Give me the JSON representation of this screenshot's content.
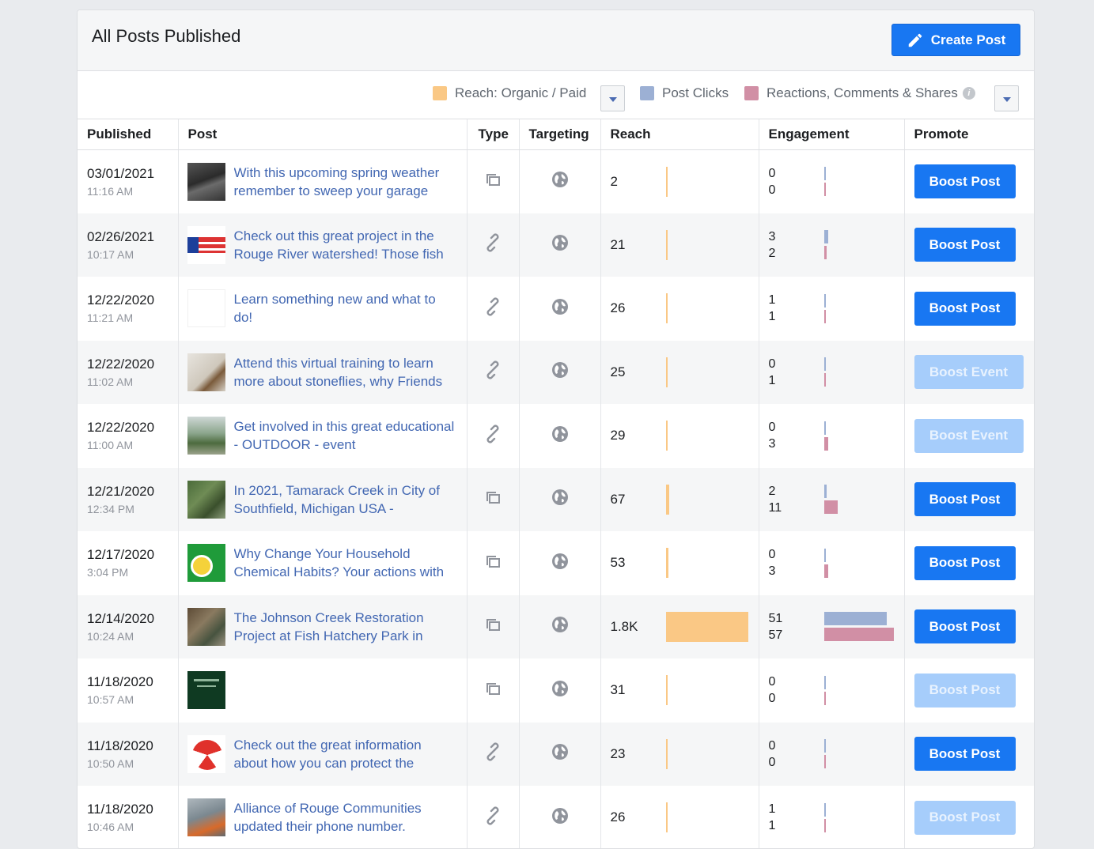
{
  "header": {
    "title": "All Posts Published",
    "create_label": "Create Post"
  },
  "legend": {
    "reach": "Reach: Organic / Paid",
    "clicks": "Post Clicks",
    "reactions": "Reactions, Comments & Shares",
    "colors": {
      "reach": "#fac885",
      "clicks": "#9cb0d4",
      "reactions": "#d18fa5"
    }
  },
  "columns": [
    "Published",
    "Post",
    "Type",
    "Targeting",
    "Reach",
    "Engagement",
    "Promote"
  ],
  "rows": [
    {
      "date": "03/01/2021",
      "time": "11:16 AM",
      "text": "With this upcoming spring weather remember to sweep your garage",
      "type": "album",
      "reach": "2",
      "reach_value": 2,
      "clicks": "0",
      "reactions": "0",
      "promote": "Boost Post",
      "promote_enabled": true,
      "thumb": "garage"
    },
    {
      "date": "02/26/2021",
      "time": "10:17 AM",
      "text": "Check out this great project in the Rouge River watershed! Those fish",
      "type": "link",
      "reach": "21",
      "reach_value": 21,
      "clicks": "3",
      "reactions": "2",
      "promote": "Boost Post",
      "promote_enabled": true,
      "thumb": "flag"
    },
    {
      "date": "12/22/2020",
      "time": "11:21 AM",
      "text": "Learn something new and what to do!",
      "type": "link",
      "reach": "26",
      "reach_value": 26,
      "clicks": "1",
      "reactions": "1",
      "promote": "Boost Post",
      "promote_enabled": true,
      "thumb": "blank"
    },
    {
      "date": "12/22/2020",
      "time": "11:02 AM",
      "text": "Attend this virtual training to learn more about stoneflies, why Friends",
      "type": "link",
      "reach": "25",
      "reach_value": 25,
      "clicks": "0",
      "reactions": "1",
      "promote": "Boost Event",
      "promote_enabled": false,
      "thumb": "stonefly"
    },
    {
      "date": "12/22/2020",
      "time": "11:00 AM",
      "text": "Get involved in this great educational - OUTDOOR - event",
      "type": "link",
      "reach": "29",
      "reach_value": 29,
      "clicks": "0",
      "reactions": "3",
      "promote": "Boost Event",
      "promote_enabled": false,
      "thumb": "outdoor"
    },
    {
      "date": "12/21/2020",
      "time": "12:34 PM",
      "text": "In 2021, Tamarack Creek in City of Southfield, Michigan USA -",
      "type": "album",
      "reach": "67",
      "reach_value": 67,
      "clicks": "2",
      "reactions": "11",
      "promote": "Boost Post",
      "promote_enabled": true,
      "thumb": "creek"
    },
    {
      "date": "12/17/2020",
      "time": "3:04 PM",
      "text": "Why Change Your Household Chemical Habits? Your actions with",
      "type": "album",
      "reach": "53",
      "reach_value": 53,
      "clicks": "0",
      "reactions": "3",
      "promote": "Boost Post",
      "promote_enabled": true,
      "thumb": "green"
    },
    {
      "date": "12/14/2020",
      "time": "10:24 AM",
      "text": "The Johnson Creek Restoration Project at Fish Hatchery Park in",
      "type": "album",
      "reach": "1.8K",
      "reach_value": 1800,
      "clicks": "51",
      "reactions": "57",
      "promote": "Boost Post",
      "promote_enabled": true,
      "thumb": "johnson"
    },
    {
      "date": "11/18/2020",
      "time": "10:57 AM",
      "text": "",
      "type": "album",
      "reach": "31",
      "reach_value": 31,
      "clicks": "0",
      "reactions": "0",
      "promote": "Boost Post",
      "promote_enabled": false,
      "thumb": "dark"
    },
    {
      "date": "11/18/2020",
      "time": "10:50 AM",
      "text": "Check out the great information about how you can protect the",
      "type": "link",
      "reach": "23",
      "reach_value": 23,
      "clicks": "0",
      "reactions": "0",
      "promote": "Boost Post",
      "promote_enabled": true,
      "thumb": "ball"
    },
    {
      "date": "11/18/2020",
      "time": "10:46 AM",
      "text": "Alliance of Rouge Communities updated their phone number.",
      "type": "link",
      "reach": "26",
      "reach_value": 26,
      "clicks": "1",
      "reactions": "1",
      "promote": "Boost Post",
      "promote_enabled": false,
      "thumb": "phone"
    }
  ]
}
